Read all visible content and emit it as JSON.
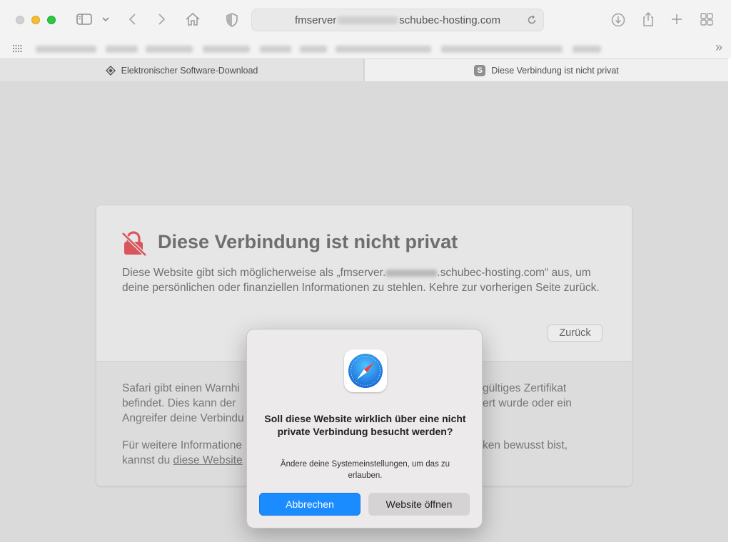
{
  "toolbar": {
    "url_prefix": "fmserver",
    "url_suffix": "schubec-hosting.com"
  },
  "tabs": [
    {
      "label": "Elektronischer Software-Download",
      "active": false
    },
    {
      "label": "Diese Verbindung ist nicht privat",
      "active": true,
      "icon_letter": "S"
    }
  ],
  "warning": {
    "title": "Diese Verbindung ist nicht privat",
    "text_before_host": "Diese Website gibt sich möglicherweise als „fmserver.",
    "text_after_host": ".schubec-hosting.com“ aus, um deine persönlichen oder finanziellen Informationen zu stehlen. Kehre zur vorherigen Seite zurück.",
    "back_label": "Zurück",
    "info_line1_left": "Safari gibt einen Warnhi",
    "info_line1_right": "gültiges Zertifikat",
    "info_line2_left": "befindet. Dies kann der",
    "info_line2_right": "ert wurde oder ein",
    "info_line3_left": "Angreifer deine Verbindu",
    "info_line4_left": "Für weitere Informatione",
    "info_line4_right": "ken bewusst bist,",
    "info_line5_left": "kannst du",
    "info_link": "diese Website"
  },
  "dialog": {
    "title": "Soll diese Website wirklich über eine nicht private Verbindung besucht werden?",
    "message": "Ändere deine Systemeinstellungen, um das zu erlauben.",
    "cancel_label": "Abbrechen",
    "open_label": "Website öffnen"
  },
  "colors": {
    "primary_button": "#1a8cff",
    "warning_icon": "#d9565c",
    "traffic_min": "#f6bd2e",
    "traffic_max": "#2bc840"
  }
}
